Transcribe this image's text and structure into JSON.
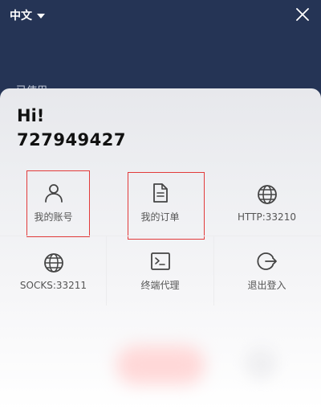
{
  "header": {
    "language": "中文",
    "behind_text": "已使用"
  },
  "profile": {
    "greeting": "Hi!",
    "user_id": "727949427"
  },
  "menu": [
    {
      "label": "我的账号",
      "icon": "user-icon"
    },
    {
      "label": "我的订单",
      "icon": "document-icon"
    },
    {
      "label": "HTTP:33210",
      "icon": "globe-icon"
    },
    {
      "label": "SOCKS:33211",
      "icon": "globe-icon"
    },
    {
      "label": "终端代理",
      "icon": "terminal-icon"
    },
    {
      "label": "退出登入",
      "icon": "logout-icon"
    }
  ],
  "colors": {
    "header_bg": "#253455",
    "highlight": "#e23a3a"
  }
}
